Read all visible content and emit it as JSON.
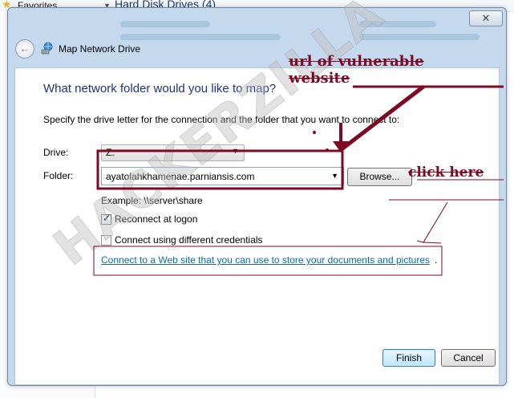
{
  "background": {
    "favorites_label": "Favorites",
    "section_title": "Hard Disk Drives (4)"
  },
  "dialog": {
    "title": "Map Network Drive",
    "close_symbol": "✕",
    "back_symbol": "←",
    "question": "What network folder would you like to map?",
    "instruction": "Specify the drive letter for the connection and the folder that you want to connect to:",
    "drive_label": "Drive:",
    "drive_value": "Z:",
    "folder_label": "Folder:",
    "folder_value": "ayatolahkhamenae.parniansis.com",
    "browse_label": "Browse...",
    "example_text": "Example: \\\\server\\share",
    "reconnect_label": "Reconnect at logon",
    "reconnect_checked": true,
    "credentials_label": "Connect using different credentials",
    "credentials_checked": false,
    "web_link_text": "Connect to a Web site that you can use to store your documents and pictures",
    "web_link_suffix": ".",
    "finish_label": "Finish",
    "cancel_label": "Cancel"
  },
  "annotations": {
    "url_note_line1": "url of vulnerable",
    "url_note_line2": "website",
    "click_note": "click here",
    "watermark": "HACKERZILLA",
    "color": "#7d0a24"
  },
  "icons": {
    "back": "back-arrow-icon",
    "network_drive": "network-drive-icon",
    "close": "close-icon",
    "dropdown": "chevron-down-icon",
    "checkmark": "checkmark-icon",
    "favorites": "star-icon"
  }
}
